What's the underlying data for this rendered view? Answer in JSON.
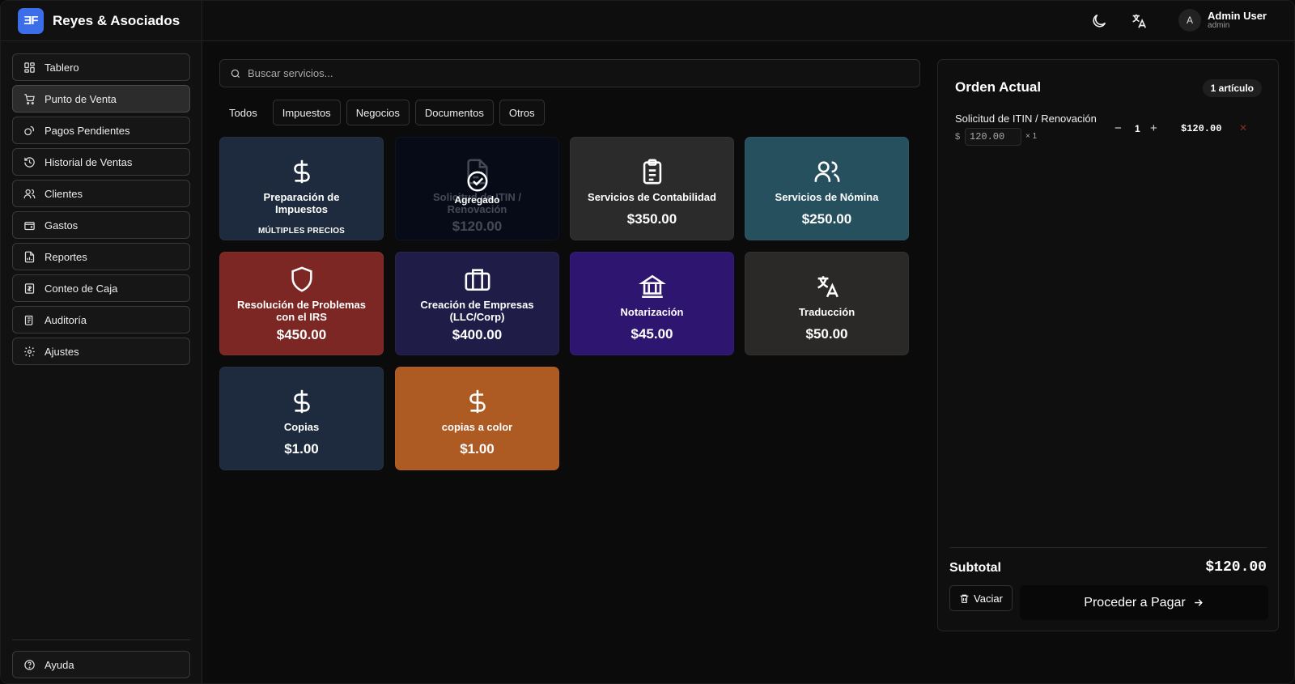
{
  "brand": {
    "logo_text": "ƎF",
    "name": "Reyes & Asociados",
    "accent": "#3b6ee8"
  },
  "sidebar": {
    "items": [
      {
        "label": "Tablero",
        "icon": "dashboard-icon"
      },
      {
        "label": "Punto de Venta",
        "icon": "cart-icon",
        "active": true
      },
      {
        "label": "Pagos Pendientes",
        "icon": "coins-icon"
      },
      {
        "label": "Historial de Ventas",
        "icon": "history-icon"
      },
      {
        "label": "Clientes",
        "icon": "users-icon"
      },
      {
        "label": "Gastos",
        "icon": "wallet-icon"
      },
      {
        "label": "Reportes",
        "icon": "report-icon"
      },
      {
        "label": "Conteo de Caja",
        "icon": "cash-icon"
      },
      {
        "label": "Auditoría",
        "icon": "audit-icon"
      },
      {
        "label": "Ajustes",
        "icon": "gear-icon"
      }
    ],
    "help_label": "Ayuda"
  },
  "header": {
    "user_initial": "A",
    "user_name": "Admin User",
    "user_role": "admin"
  },
  "search": {
    "placeholder": "Buscar servicios..."
  },
  "tabs": [
    "Todos",
    "Impuestos",
    "Negocios",
    "Documentos",
    "Otros"
  ],
  "services": [
    {
      "title": "Preparación de Impuestos",
      "subtitle": "MÚLTIPLES PRECIOS",
      "color": "#1e2a3d",
      "icon": "dollar-icon"
    },
    {
      "title": "Solicitud de ITIN / Renovación",
      "price": "$120.00",
      "color": "#070b18",
      "icon": "document-icon",
      "added_label": "Agregado"
    },
    {
      "title": "Servicios de Contabilidad",
      "price": "$350.00",
      "color": "#2b2b2b",
      "icon": "clipboard-icon"
    },
    {
      "title": "Servicios de Nómina",
      "price": "$250.00",
      "color": "#27505f",
      "icon": "users-icon"
    },
    {
      "title": "Resolución de Problemas con el IRS",
      "price": "$450.00",
      "color": "#7c2724",
      "icon": "shield-icon"
    },
    {
      "title": "Creación de Empresas (LLC/Corp)",
      "price": "$400.00",
      "color": "#1f1c48",
      "icon": "briefcase-icon"
    },
    {
      "title": "Notarización",
      "price": "$45.00",
      "color": "#2d1570",
      "icon": "bank-icon"
    },
    {
      "title": "Traducción",
      "price": "$50.00",
      "color": "#2b2928",
      "icon": "translate-icon"
    },
    {
      "title": "Copias",
      "price": "$1.00",
      "color": "#1e2a3d",
      "icon": "dollar-icon"
    },
    {
      "title": "copias a color",
      "price": "$1.00",
      "color": "#ad5a23",
      "icon": "dollar-icon"
    }
  ],
  "order": {
    "title": "Orden Actual",
    "count_label": "1 artículo",
    "line": {
      "name": "Solicitud de ITIN / Renovación",
      "currency": "$",
      "unit_price": "120.00",
      "times": "× 1",
      "minus": "−",
      "qty": "1",
      "plus": "+",
      "total": "$120.00",
      "remove": "✕"
    },
    "subtotal_label": "Subtotal",
    "subtotal_value": "$120.00",
    "clear_label": "Vaciar",
    "pay_label": "Proceder a Pagar"
  }
}
